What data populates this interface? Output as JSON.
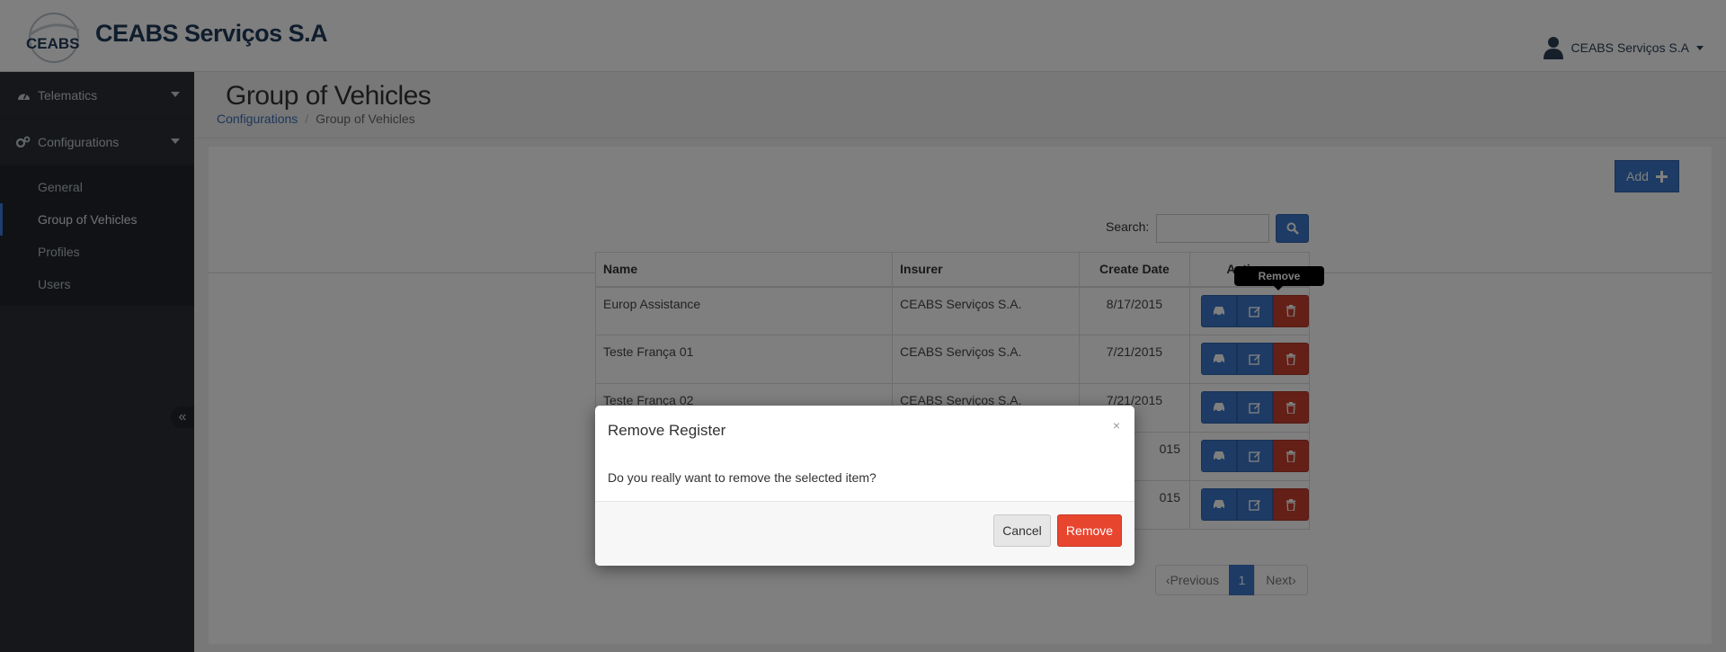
{
  "header": {
    "logo_text": "CEABS",
    "brand": "CEABS Serviços S.A",
    "user_name": "CEABS Serviços S.A"
  },
  "sidebar": {
    "groups": [
      {
        "label": "Telematics",
        "icon": "dashboard-icon"
      },
      {
        "label": "Configurations",
        "icon": "cogs-icon"
      }
    ],
    "subitems": [
      {
        "label": "General",
        "active": false
      },
      {
        "label": "Group of Vehicles",
        "active": true
      },
      {
        "label": "Profiles",
        "active": false
      },
      {
        "label": "Users",
        "active": false
      }
    ],
    "collapse_icon": "«"
  },
  "page": {
    "title": "Group of Vehicles",
    "breadcrumb": {
      "parent": "Configurations",
      "separator": "/",
      "current": "Group of Vehicles"
    },
    "add_label": "Add"
  },
  "search": {
    "label": "Search:",
    "value": "",
    "placeholder": ""
  },
  "table": {
    "headers": {
      "name": "Name",
      "insurer": "Insurer",
      "create_date": "Create Date",
      "actions": "Actions"
    },
    "rows": [
      {
        "name": "Europ Assistance",
        "insurer": "CEABS Serviços S.A.",
        "create_date": "8/17/2015"
      },
      {
        "name": "Teste França 01",
        "insurer": "CEABS Serviços S.A.",
        "create_date": "7/21/2015"
      },
      {
        "name": "Teste França 02",
        "insurer": "CEABS Serviços S.A.",
        "create_date": "7/21/2015"
      },
      {
        "name": "",
        "insurer": "",
        "create_date": "015"
      },
      {
        "name": "",
        "insurer": "",
        "create_date": "015"
      }
    ]
  },
  "tooltip": {
    "text": "Remove"
  },
  "pagination": {
    "previous": "Previous",
    "page": "1",
    "next": "Next"
  },
  "modal": {
    "title": "Remove Register",
    "close": "×",
    "body": "Do you really want to remove the selected item?",
    "cancel": "Cancel",
    "remove": "Remove"
  },
  "colors": {
    "primary": "#3a77c9",
    "danger": "#c9402e",
    "modal_danger": "#e8452f",
    "sidebar_bg": "#2a2f36",
    "brand_text": "#1f3a5a"
  }
}
